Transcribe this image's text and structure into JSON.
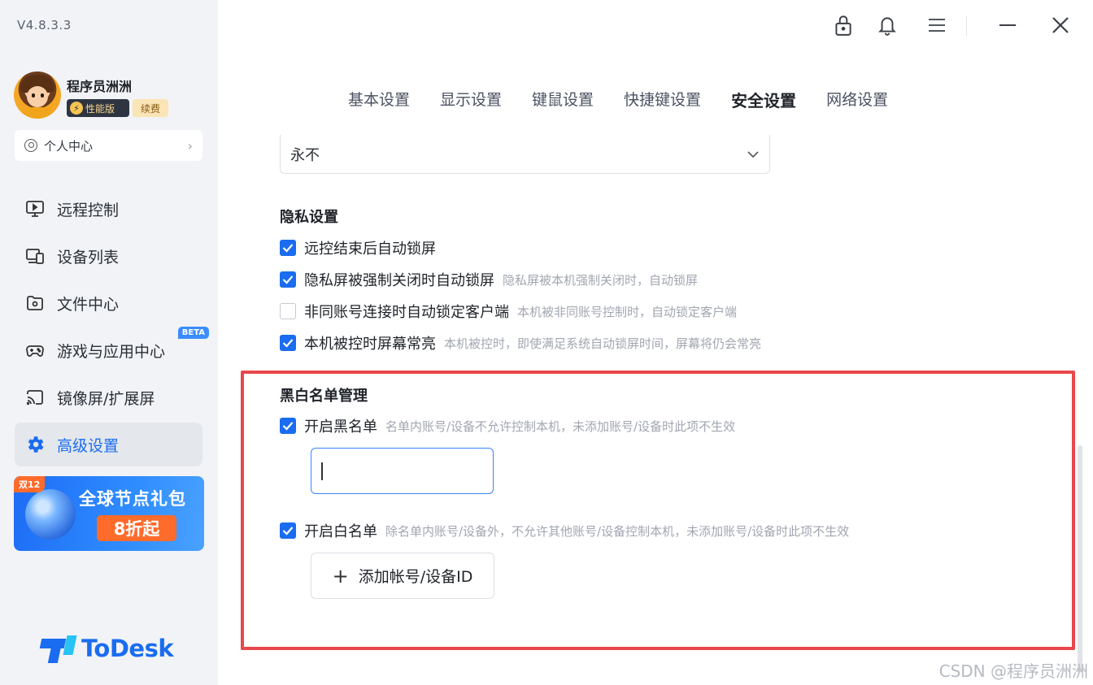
{
  "app": {
    "version": "V4.8.3.3",
    "brand": "ToDesk"
  },
  "user": {
    "name": "程序员洲洲",
    "badge_perf": "性能版",
    "badge_renew": "续费",
    "personal_center": "个人中心"
  },
  "sidebar": {
    "items": [
      {
        "label": "远程控制",
        "icon": "monitor-icon"
      },
      {
        "label": "设备列表",
        "icon": "devices-icon"
      },
      {
        "label": "文件中心",
        "icon": "folder-icon"
      },
      {
        "label": "游戏与应用中心",
        "icon": "gamepad-icon",
        "badge": "BETA"
      },
      {
        "label": "镜像屏/扩展屏",
        "icon": "cast-icon"
      },
      {
        "label": "高级设置",
        "icon": "gear-icon",
        "active": true
      }
    ],
    "promo": {
      "tag": "双12",
      "title": "全球节点礼包",
      "discount": "8折起"
    }
  },
  "titlebar": {
    "icons": [
      "lock-icon",
      "bell-icon",
      "menu-icon",
      "minimize-icon",
      "close-icon"
    ]
  },
  "tabs": [
    {
      "label": "基本设置"
    },
    {
      "label": "显示设置"
    },
    {
      "label": "键鼠设置"
    },
    {
      "label": "快捷键设置"
    },
    {
      "label": "安全设置",
      "active": true
    },
    {
      "label": "网络设置"
    }
  ],
  "content": {
    "lock_select_value": "永不",
    "privacy": {
      "title": "隐私设置",
      "options": [
        {
          "label": "远控结束后自动锁屏",
          "desc": "",
          "checked": true
        },
        {
          "label": "隐私屏被强制关闭时自动锁屏",
          "desc": "隐私屏被本机强制关闭时，自动锁屏",
          "checked": true
        },
        {
          "label": "非同账号连接时自动锁定客户端",
          "desc": "本机被非同账号控制时，自动锁定客户端",
          "checked": false
        },
        {
          "label": "本机被控时屏幕常亮",
          "desc": "本机被控时，即使满足系统自动锁屏时间，屏幕将仍会常亮",
          "checked": true
        }
      ]
    },
    "blackwhite": {
      "title": "黑白名单管理",
      "blacklist": {
        "label": "开启黑名单",
        "desc": "名单内账号/设备不允许控制本机，未添加账号/设备时此项不生效",
        "checked": true,
        "input_value": ""
      },
      "whitelist": {
        "label": "开启白名单",
        "desc": "除名单内账号/设备外，不允许其他账号/设备控制本机，未添加账号/设备时此项不生效",
        "checked": true
      },
      "add_button": "添加帐号/设备ID"
    }
  },
  "watermark": "CSDN @程序员洲洲",
  "colors": {
    "accent": "#1a6cf0",
    "highlight_border": "#e8474b",
    "sidebar_bg": "#f1f3f6"
  }
}
